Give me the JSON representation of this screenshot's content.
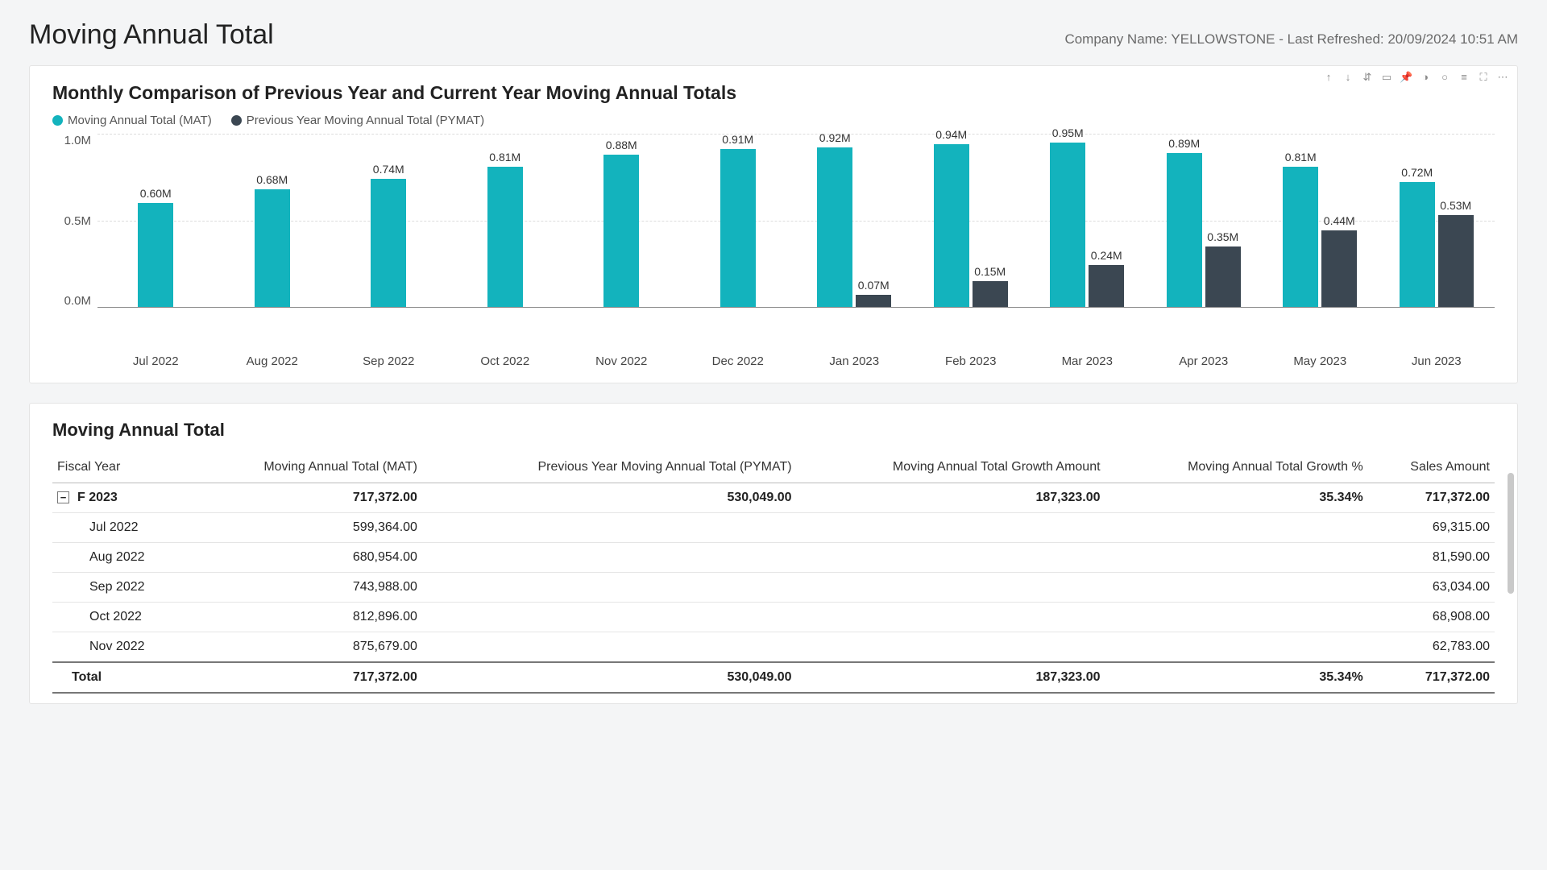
{
  "header": {
    "title": "Moving Annual Total",
    "meta": "Company Name: YELLOWSTONE - Last Refreshed: 20/09/2024 10:51 AM"
  },
  "chart": {
    "title": "Monthly Comparison of Previous Year and Current Year Moving Annual Totals",
    "legend": {
      "mat": "Moving Annual Total (MAT)",
      "pymat": "Previous Year Moving Annual Total (PYMAT)"
    },
    "colors": {
      "mat": "#13b3bd",
      "pymat": "#3b4752"
    },
    "yticks": [
      "1.0M",
      "0.5M",
      "0.0M"
    ]
  },
  "chart_data": {
    "type": "bar",
    "title": "Monthly Comparison of Previous Year and Current Year Moving Annual Totals",
    "xlabel": "",
    "ylabel": "",
    "ylim": [
      0,
      1.0
    ],
    "y_unit": "M",
    "categories": [
      "Jul 2022",
      "Aug 2022",
      "Sep 2022",
      "Oct 2022",
      "Nov 2022",
      "Dec 2022",
      "Jan 2023",
      "Feb 2023",
      "Mar 2023",
      "Apr 2023",
      "May 2023",
      "Jun 2023"
    ],
    "series": [
      {
        "name": "Moving Annual Total (MAT)",
        "color": "#13b3bd",
        "values": [
          0.6,
          0.68,
          0.74,
          0.81,
          0.88,
          0.91,
          0.92,
          0.94,
          0.95,
          0.89,
          0.81,
          0.72
        ],
        "labels": [
          "0.60M",
          "0.68M",
          "0.74M",
          "0.81M",
          "0.88M",
          "0.91M",
          "0.92M",
          "0.94M",
          "0.95M",
          "0.89M",
          "0.81M",
          "0.72M"
        ]
      },
      {
        "name": "Previous Year Moving Annual Total (PYMAT)",
        "color": "#3b4752",
        "values": [
          null,
          null,
          null,
          null,
          null,
          null,
          0.07,
          0.15,
          0.24,
          0.35,
          0.44,
          0.53
        ],
        "labels": [
          null,
          null,
          null,
          null,
          null,
          null,
          "0.07M",
          "0.15M",
          "0.24M",
          "0.35M",
          "0.44M",
          "0.53M"
        ]
      }
    ]
  },
  "table": {
    "title": "Moving Annual Total",
    "columns": [
      "Fiscal Year",
      "Moving Annual Total (MAT)",
      "Previous Year Moving Annual Total (PYMAT)",
      "Moving Annual Total Growth Amount",
      "Moving Annual Total Growth %",
      "Sales Amount"
    ],
    "group": {
      "label": "F 2023",
      "mat": "717,372.00",
      "pymat": "530,049.00",
      "growth_amt": "187,323.00",
      "growth_pct": "35.34%",
      "sales": "717,372.00"
    },
    "rows": [
      {
        "label": "Jul 2022",
        "mat": "599,364.00",
        "sales": "69,315.00"
      },
      {
        "label": "Aug 2022",
        "mat": "680,954.00",
        "sales": "81,590.00"
      },
      {
        "label": "Sep 2022",
        "mat": "743,988.00",
        "sales": "63,034.00"
      },
      {
        "label": "Oct 2022",
        "mat": "812,896.00",
        "sales": "68,908.00"
      },
      {
        "label": "Nov 2022",
        "mat": "875,679.00",
        "sales": "62,783.00"
      }
    ],
    "total": {
      "label": "Total",
      "mat": "717,372.00",
      "pymat": "530,049.00",
      "growth_amt": "187,323.00",
      "growth_pct": "35.34%",
      "sales": "717,372.00"
    }
  },
  "toolbar_icons": [
    "↑",
    "↓",
    "⇵",
    "▭",
    "📌",
    "◑",
    "○",
    "≡",
    "⛶",
    "⋯"
  ]
}
